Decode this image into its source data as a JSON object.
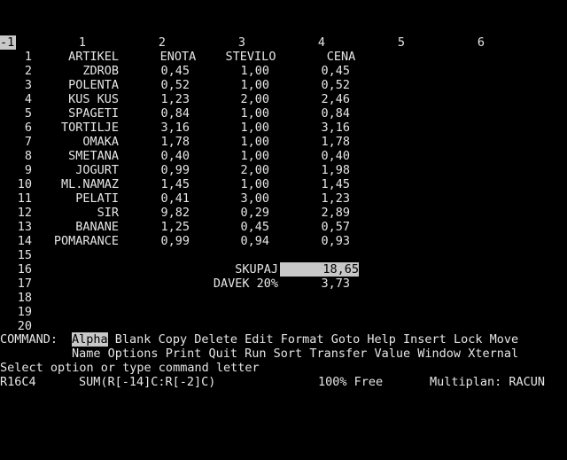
{
  "corner_label": "-1",
  "column_headers": [
    "1",
    "2",
    "3",
    "4",
    "5",
    "6"
  ],
  "row_numbers": [
    "1",
    "2",
    "3",
    "4",
    "5",
    "6",
    "7",
    "8",
    "9",
    "10",
    "11",
    "12",
    "13",
    "14",
    "15",
    "16",
    "17",
    "18",
    "19",
    "20"
  ],
  "headers": {
    "artikel": "ARTIKEL",
    "enota": "ENOTA",
    "stevilo": "STEVILO",
    "cena": "CENA"
  },
  "items": [
    {
      "name": "ZDROB",
      "enota": "0,45",
      "stevilo": "1,00",
      "cena": "0,45"
    },
    {
      "name": "POLENTA",
      "enota": "0,52",
      "stevilo": "1,00",
      "cena": "0,52"
    },
    {
      "name": "KUS KUS",
      "enota": "1,23",
      "stevilo": "2,00",
      "cena": "2,46"
    },
    {
      "name": "SPAGETI",
      "enota": "0,84",
      "stevilo": "1,00",
      "cena": "0,84"
    },
    {
      "name": "TORTILJE",
      "enota": "3,16",
      "stevilo": "1,00",
      "cena": "3,16"
    },
    {
      "name": "OMAKA",
      "enota": "1,78",
      "stevilo": "1,00",
      "cena": "1,78"
    },
    {
      "name": "SMETANA",
      "enota": "0,40",
      "stevilo": "1,00",
      "cena": "0,40"
    },
    {
      "name": "JOGURT",
      "enota": "0,99",
      "stevilo": "2,00",
      "cena": "1,98"
    },
    {
      "name": "ML.NAMAZ",
      "enota": "1,45",
      "stevilo": "1,00",
      "cena": "1,45"
    },
    {
      "name": "PELATI",
      "enota": "0,41",
      "stevilo": "3,00",
      "cena": "1,23"
    },
    {
      "name": "SIR",
      "enota": "9,82",
      "stevilo": "0,29",
      "cena": "2,89"
    },
    {
      "name": "BANANE",
      "enota": "1,25",
      "stevilo": "0,45",
      "cena": "0,57"
    },
    {
      "name": "POMARANCE",
      "enota": "0,99",
      "stevilo": "0,94",
      "cena": "0,93"
    }
  ],
  "summary": {
    "skupaj_label": "SKUPAJ",
    "skupaj_value": "18,65",
    "davek_label": "DAVEK 20%",
    "davek_value": "3,73"
  },
  "command": {
    "prefix": "COMMAND:",
    "line1": [
      "Alpha",
      "Blank",
      "Copy",
      "Delete",
      "Edit",
      "Format",
      "Goto",
      "Help",
      "Insert",
      "Lock",
      "Move"
    ],
    "line2": [
      "Name",
      "Options",
      "Print",
      "Quit",
      "Run",
      "Sort",
      "Transfer",
      "Value",
      "Window",
      "Xternal"
    ],
    "selected": "Alpha",
    "prompt": "Select option or type command letter"
  },
  "status": {
    "cell_ref": "R16C4",
    "formula": "SUM(R[-14]C:R[-2]C)",
    "memory": "100% Free",
    "app": "Multiplan: RACUN"
  },
  "colors": {
    "background": "#000000",
    "text": "#e6e6e6",
    "highlight": "#c8c8c8"
  }
}
